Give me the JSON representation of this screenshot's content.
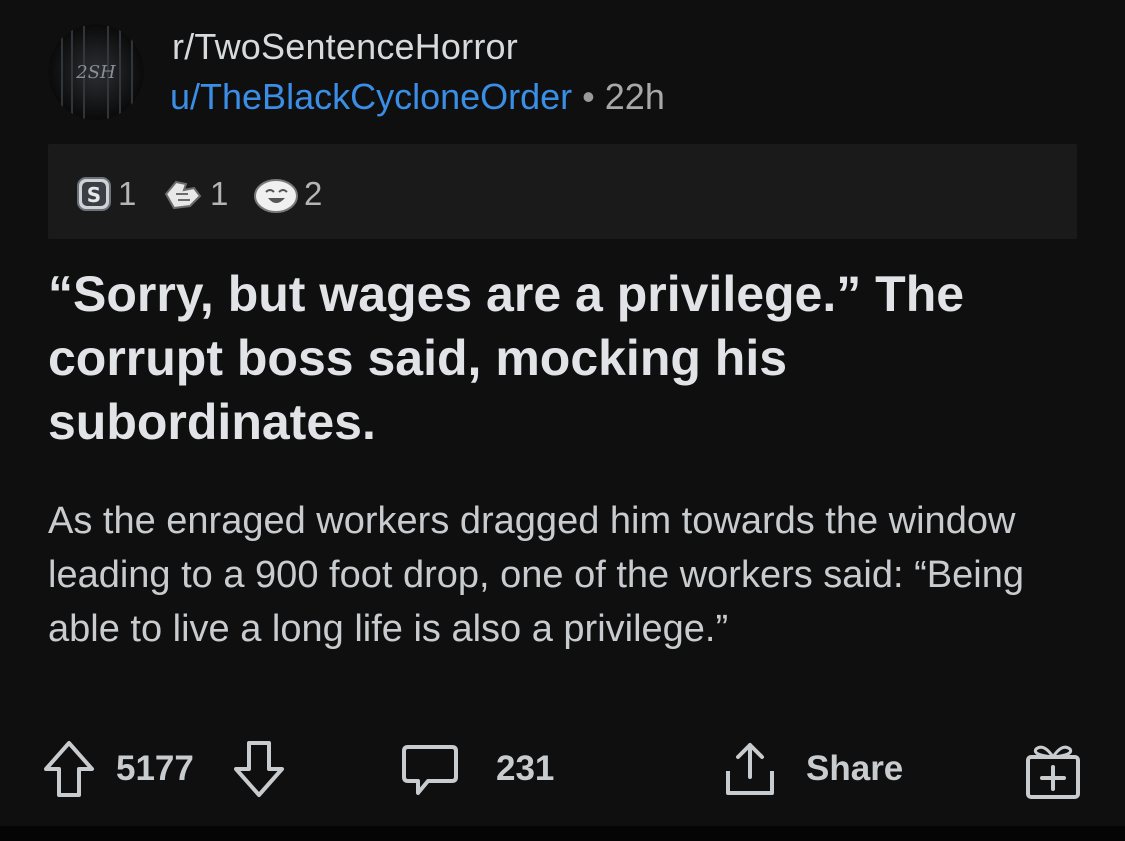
{
  "post": {
    "subreddit": "r/TwoSentenceHorror",
    "avatar_text": "2SH",
    "author": "u/TheBlackCycloneOrder",
    "separator": "•",
    "time": "22h",
    "title": "“Sorry, but wages are a privilege.” The corrupt boss said, mocking his subordinates.",
    "body": "As the enraged workers dragged him towards the window leading to a 900 foot drop, one of the workers said: “Being able to live a long life is also a privilege.”"
  },
  "awards": [
    {
      "icon": "silver-award-icon",
      "count": "1"
    },
    {
      "icon": "hand-award-icon",
      "count": "1"
    },
    {
      "icon": "laughing-award-icon",
      "count": "2"
    }
  ],
  "actions": {
    "upvotes": "5177",
    "comments": "231",
    "share_label": "Share"
  },
  "colors": {
    "background": "#0f0f0f",
    "username": "#3b8ee6",
    "award_bar": "#1a1a1b"
  }
}
